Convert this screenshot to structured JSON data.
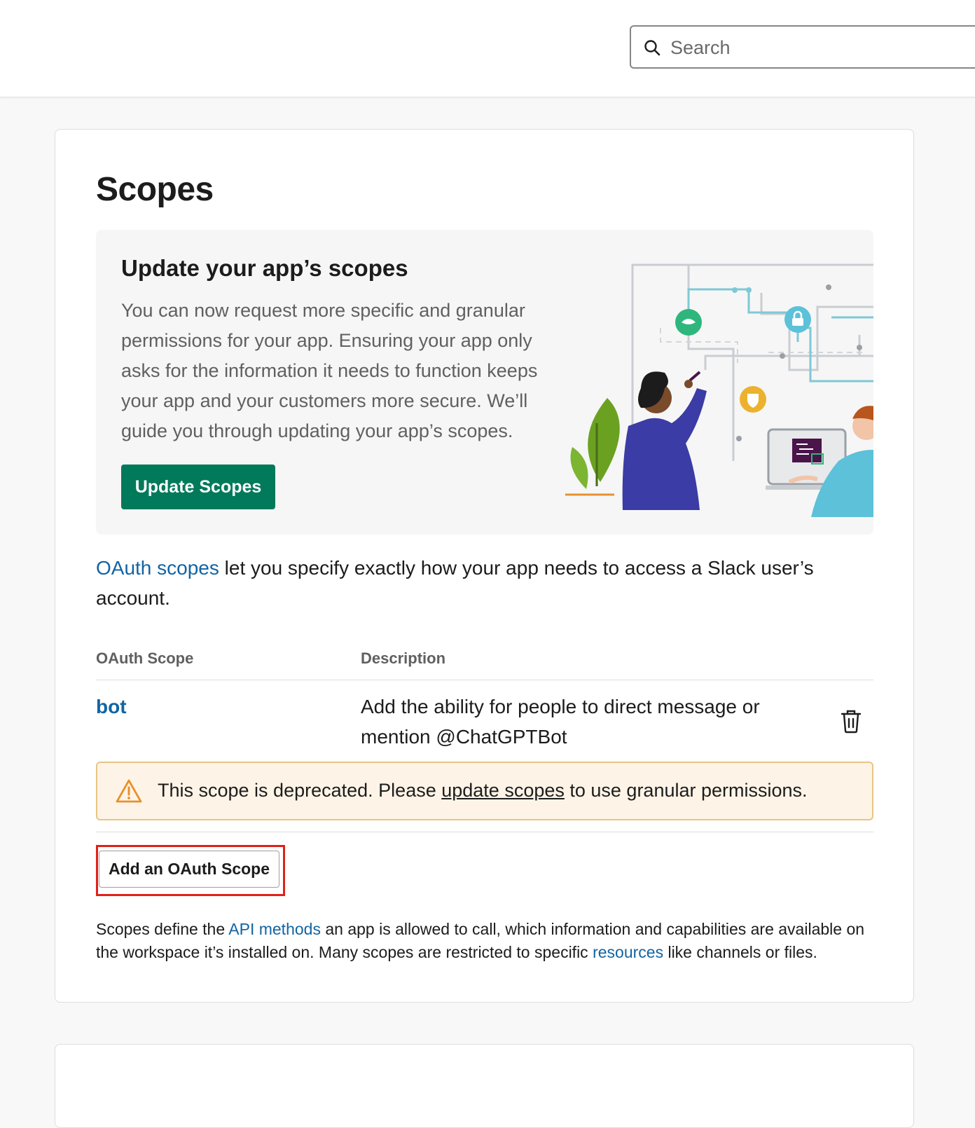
{
  "search": {
    "placeholder": "Search"
  },
  "scopes": {
    "title": "Scopes",
    "banner": {
      "title": "Update your app’s scopes",
      "text": "You can now request more specific and granular permissions for your app. Ensuring your app only asks for the information it needs to function keeps your app and your customers more secure. We’ll guide you through updating your app’s scopes.",
      "button_label": "Update Scopes"
    },
    "intro": {
      "link": "OAuth scopes",
      "text": " let you specify exactly how your app needs to access a Slack user’s account."
    },
    "table": {
      "headers": [
        "OAuth Scope",
        "Description"
      ],
      "rows": [
        {
          "scope": "bot",
          "description": "Add the ability for people to direct message or mention @ChatGPTBot"
        }
      ]
    },
    "warning": {
      "before": "This scope is deprecated. Please ",
      "link": "update scopes",
      "after": " to use granular permissions."
    },
    "add_button_label": "Add an OAuth Scope",
    "footnote": {
      "part1": "Scopes define the ",
      "link1": "API methods",
      "part2": " an app is allowed to call, which information and capabilities are available on the workspace it’s installed on. Many scopes are restricted to specific ",
      "link2": "resources",
      "part3": " like channels or files."
    }
  },
  "colors": {
    "primary_button": "#007a5a",
    "link": "#1264a3",
    "warning_bg": "#fdf4e7",
    "highlight": "#e0211a"
  },
  "icons": [
    "search-icon",
    "trash-icon",
    "warning-icon"
  ]
}
